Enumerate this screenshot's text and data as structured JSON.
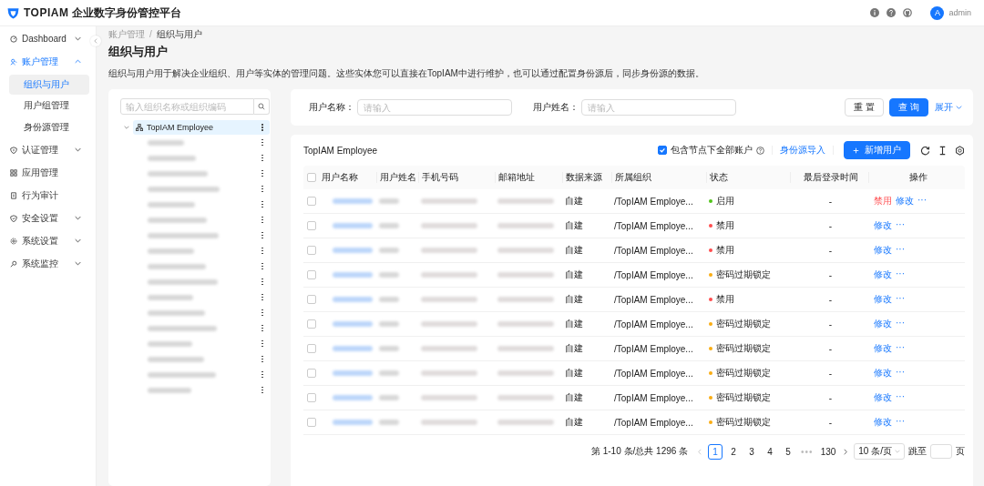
{
  "header": {
    "logo": "TOPIAM",
    "title": "企业数字身份管控平台",
    "user": {
      "avatar": "A",
      "name": "admin"
    }
  },
  "sidebar": {
    "items": [
      {
        "label": "Dashboard",
        "expandable": true,
        "expanded": false
      },
      {
        "label": "账户管理",
        "expandable": true,
        "expanded": true,
        "children": [
          {
            "label": "组织与用户",
            "selected": true
          },
          {
            "label": "用户组管理",
            "selected": false
          },
          {
            "label": "身份源管理",
            "selected": false
          }
        ]
      },
      {
        "label": "认证管理",
        "expandable": true,
        "expanded": false
      },
      {
        "label": "应用管理",
        "expandable": false,
        "expanded": false
      },
      {
        "label": "行为审计",
        "expandable": false,
        "expanded": false
      },
      {
        "label": "安全设置",
        "expandable": true,
        "expanded": false
      },
      {
        "label": "系统设置",
        "expandable": true,
        "expanded": false
      },
      {
        "label": "系统监控",
        "expandable": true,
        "expanded": false
      }
    ]
  },
  "breadcrumb": [
    "账户管理",
    "组织与用户"
  ],
  "breadcrumb_separator": "/",
  "page_title": "组织与用户",
  "description": "组织与用户用于解决企业组织、用户等实体的管理问题。这些实体您可以直接在TopIAM中进行维护，也可以通过配置身份源后，同步身份源的数据。",
  "tree": {
    "placeholder": "输入组织名称或组织编码",
    "root": {
      "label": "TopIAM Employee",
      "expanded": true,
      "selected": true,
      "children": [
        {
          "blurred": true
        },
        {
          "blurred": true
        },
        {
          "blurred": true
        },
        {
          "blurred": true
        },
        {
          "blurred": true
        },
        {
          "blurred": true
        },
        {
          "blurred": true
        },
        {
          "blurred": true
        },
        {
          "blurred": true
        },
        {
          "blurred": true
        },
        {
          "blurred": true
        },
        {
          "blurred": true
        },
        {
          "blurred": true
        },
        {
          "blurred": true
        },
        {
          "blurred": true
        },
        {
          "blurred": true
        },
        {
          "blurred": true
        }
      ]
    }
  },
  "filters": [
    {
      "label": "用户名称：",
      "placeholder": "请输入"
    },
    {
      "label": "用户姓名：",
      "placeholder": "请输入"
    }
  ],
  "filter_buttons": {
    "reset": "重 置",
    "query": "查 询",
    "expand": "展开"
  },
  "table": {
    "title": "TopIAM Employee",
    "include_all": {
      "label": "包含节点下全部账户",
      "checked": true
    },
    "import_link": "身份源导入",
    "add_button": "新增用户",
    "all_checked": false,
    "columns": [
      "用户名称",
      "用户姓名",
      "手机号码",
      "邮箱地址",
      "数据来源",
      "所属组织",
      "状态",
      "最后登录时间",
      "操作"
    ],
    "rows": [
      {
        "checked": false,
        "blurred": true,
        "source": "自建",
        "org": "/TopIAM Employe...",
        "status": "启用",
        "color": "#52c41a",
        "last_login": "-",
        "actions": [
          {
            "label": "禁用",
            "kind": "danger"
          },
          {
            "label": "修改",
            "kind": "link"
          }
        ],
        "more": "···"
      },
      {
        "checked": false,
        "blurred": true,
        "source": "自建",
        "org": "/TopIAM Employe...",
        "status": "禁用",
        "color": "#ff4d4f",
        "last_login": "-",
        "actions": [
          {
            "label": "修改",
            "kind": "link"
          }
        ],
        "more": "···"
      },
      {
        "checked": false,
        "blurred": true,
        "source": "自建",
        "org": "/TopIAM Employe...",
        "status": "禁用",
        "color": "#ff4d4f",
        "last_login": "-",
        "actions": [
          {
            "label": "修改",
            "kind": "link"
          }
        ],
        "more": "···"
      },
      {
        "checked": false,
        "blurred": true,
        "source": "自建",
        "org": "/TopIAM Employe...",
        "status": "密码过期锁定",
        "color": "#faad14",
        "last_login": "-",
        "actions": [
          {
            "label": "修改",
            "kind": "link"
          }
        ],
        "more": "···"
      },
      {
        "checked": false,
        "blurred": true,
        "source": "自建",
        "org": "/TopIAM Employe...",
        "status": "禁用",
        "color": "#ff4d4f",
        "last_login": "-",
        "actions": [
          {
            "label": "修改",
            "kind": "link"
          }
        ],
        "more": "···"
      },
      {
        "checked": false,
        "blurred": true,
        "source": "自建",
        "org": "/TopIAM Employe...",
        "status": "密码过期锁定",
        "color": "#faad14",
        "last_login": "-",
        "actions": [
          {
            "label": "修改",
            "kind": "link"
          }
        ],
        "more": "···"
      },
      {
        "checked": false,
        "blurred": true,
        "source": "自建",
        "org": "/TopIAM Employe...",
        "status": "密码过期锁定",
        "color": "#faad14",
        "last_login": "-",
        "actions": [
          {
            "label": "修改",
            "kind": "link"
          }
        ],
        "more": "···"
      },
      {
        "checked": false,
        "blurred": true,
        "source": "自建",
        "org": "/TopIAM Employe...",
        "status": "密码过期锁定",
        "color": "#faad14",
        "last_login": "-",
        "actions": [
          {
            "label": "修改",
            "kind": "link"
          }
        ],
        "more": "···"
      },
      {
        "checked": false,
        "blurred": true,
        "source": "自建",
        "org": "/TopIAM Employe...",
        "status": "密码过期锁定",
        "color": "#faad14",
        "last_login": "-",
        "actions": [
          {
            "label": "修改",
            "kind": "link"
          }
        ],
        "more": "···"
      },
      {
        "checked": false,
        "blurred": true,
        "source": "自建",
        "org": "/TopIAM Employe...",
        "status": "密码过期锁定",
        "color": "#faad14",
        "last_login": "-",
        "actions": [
          {
            "label": "修改",
            "kind": "link"
          }
        ],
        "more": "···"
      }
    ]
  },
  "pagination": {
    "summary": "第 1-10 条/总共 1296 条",
    "pages": [
      {
        "label": "1",
        "kind": "page",
        "selected": true
      },
      {
        "label": "2",
        "kind": "page",
        "selected": false
      },
      {
        "label": "3",
        "kind": "page",
        "selected": false
      },
      {
        "label": "4",
        "kind": "page",
        "selected": false
      },
      {
        "label": "5",
        "kind": "page",
        "selected": false
      },
      {
        "label": "•••",
        "kind": "ellipsis",
        "selected": false
      },
      {
        "label": "130",
        "kind": "page",
        "selected": false
      }
    ],
    "page_size": "10 条/页",
    "jump_label": "跳至",
    "jump_suffix": "页"
  }
}
